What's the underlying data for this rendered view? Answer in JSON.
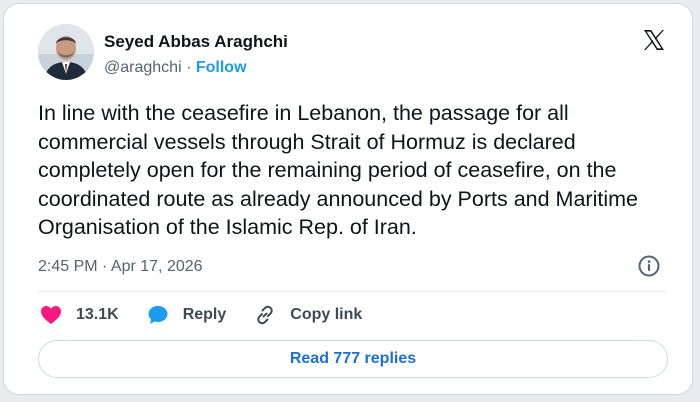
{
  "author": {
    "name": "Seyed Abbas Araghchi",
    "handle": "@araghchi",
    "separator": "·",
    "follow_label": "Follow"
  },
  "tweet": {
    "text": "In line with the ceasefire in Lebanon, the passage for all commercial vessels through Strait of Hormuz is declared completely open for the remaining period of ceasefire, on the coordinated route as already announced by Ports and Maritime Organisation of the Islamic Rep. of Iran.",
    "timestamp": "2:45 PM · Apr 17, 2026"
  },
  "actions": {
    "likes_count": "13.1K",
    "reply_label": "Reply",
    "copy_link_label": "Copy link"
  },
  "replies_button_label": "Read 777 replies",
  "icons": {
    "like": "heart-icon",
    "reply": "speech-bubble-icon",
    "copy": "link-icon",
    "info": "info-icon",
    "logo": "x-logo-icon"
  },
  "colors": {
    "heart": "#f91880",
    "reply_bubble": "#1d9bf0",
    "link": "#1d9bf0"
  }
}
